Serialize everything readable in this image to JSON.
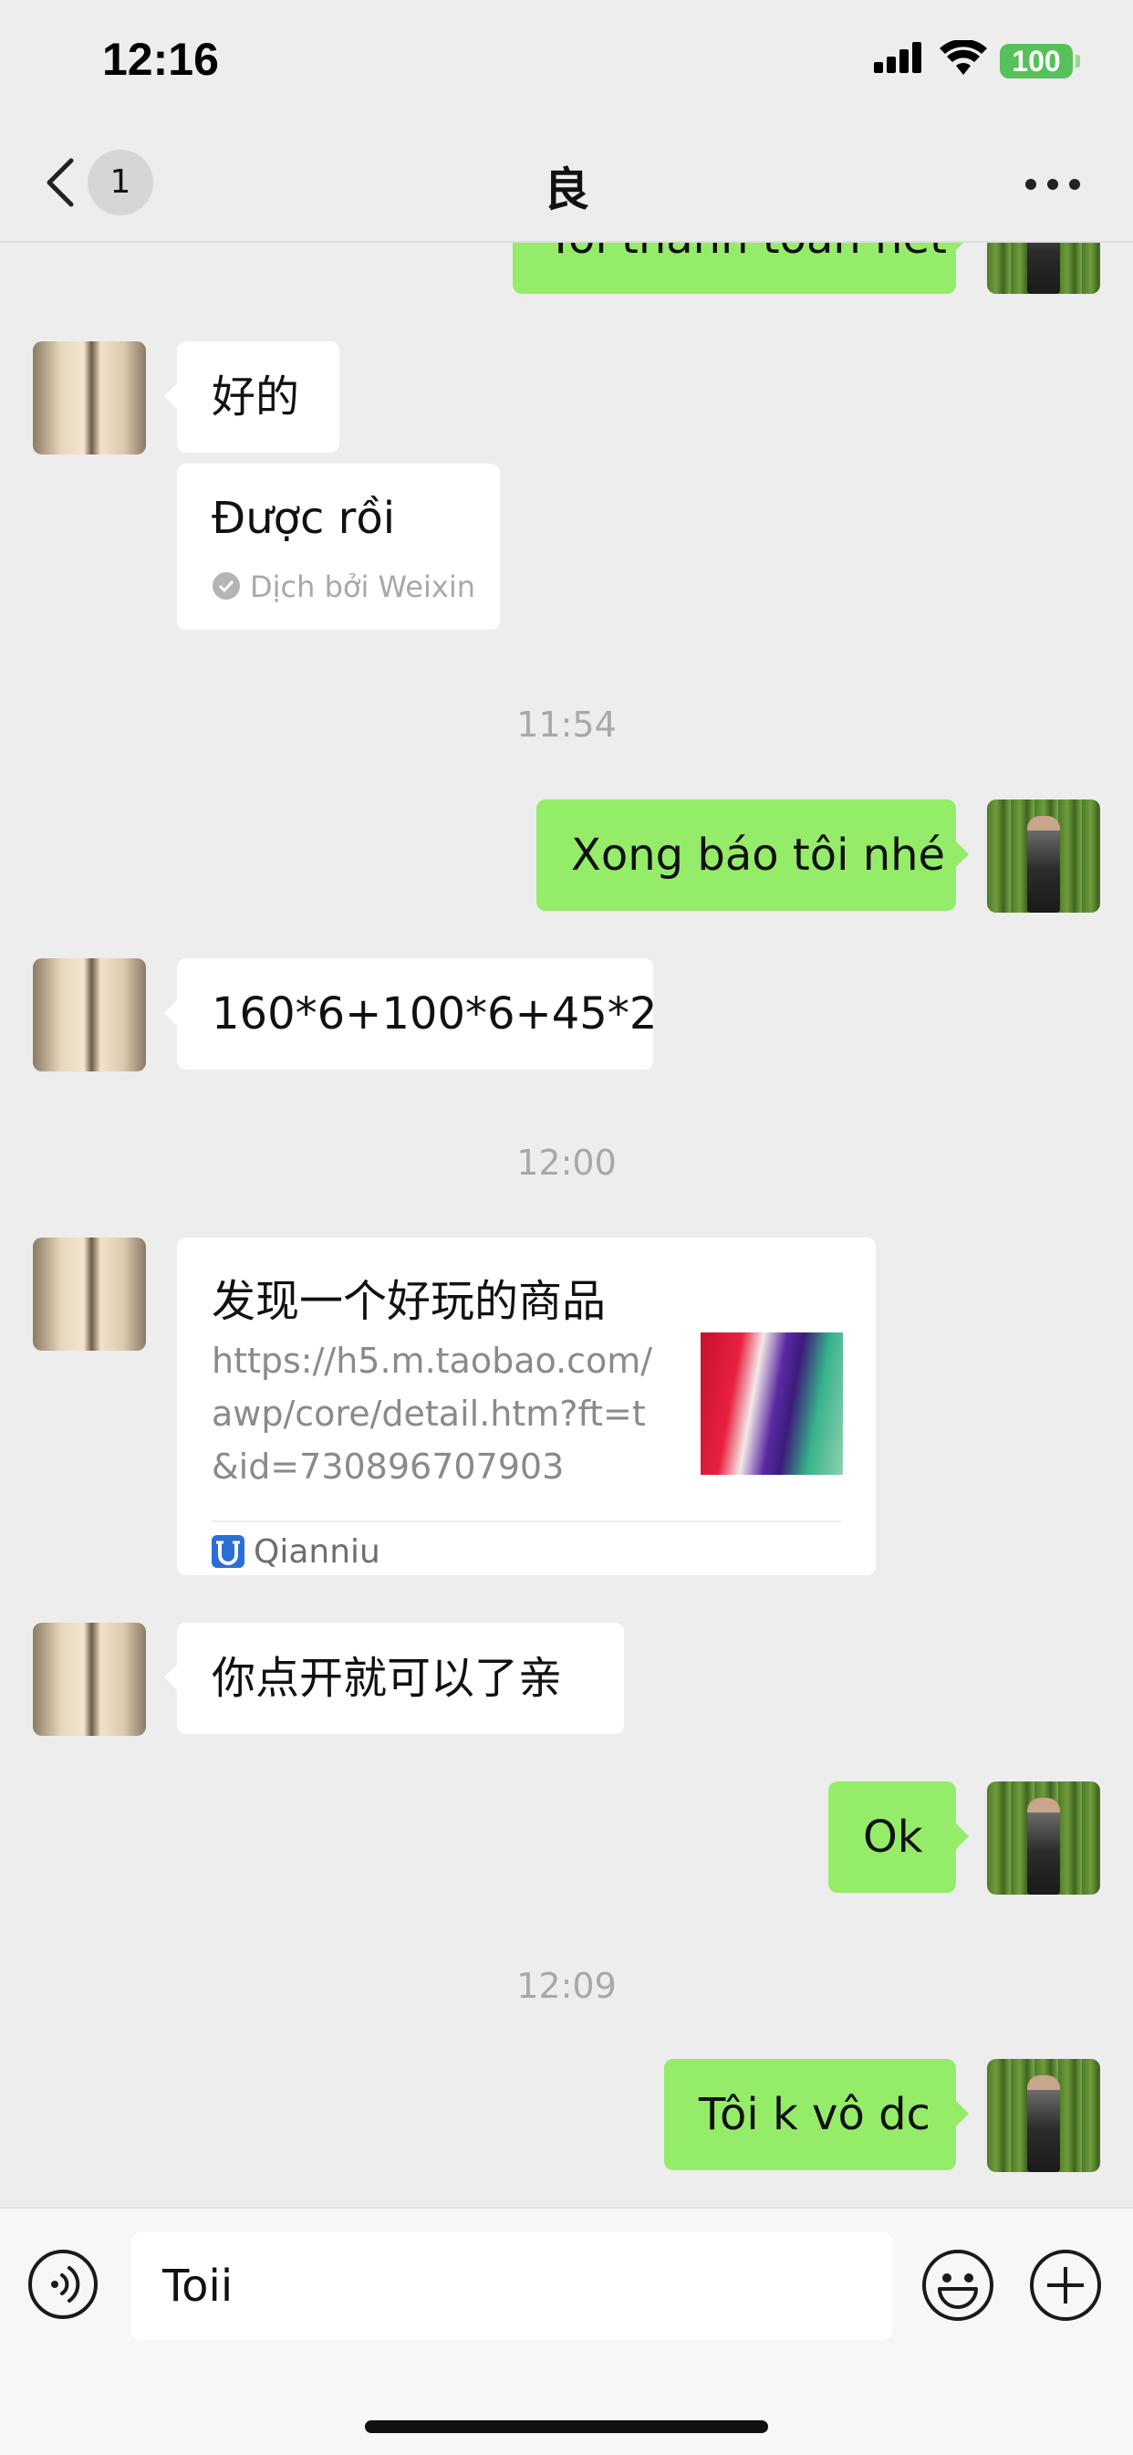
{
  "status": {
    "time": "12:16",
    "battery": "100"
  },
  "header": {
    "unread": "1",
    "title": "良"
  },
  "messages": {
    "m0": "Tôi thanh toán hết",
    "m1": "好的",
    "m2_translation": "Được rồi",
    "m2_source": "Dịch bởi Weixin",
    "ts1": "11:54",
    "m3": "Xong báo tôi nhé",
    "m4": "160*6+100*6+45*2",
    "ts2": "12:00",
    "card": {
      "title": "发现一个好玩的商品",
      "url_line1": "https://h5.m.taobao.com/",
      "url_line2": "awp/core/detail.htm?ft=t",
      "url_line3": "&id=730896707903",
      "source": "Qianniu"
    },
    "m5": "你点开就可以了亲",
    "m6": "Ok",
    "ts3": "12:09",
    "m7": "Tôi k vô dc"
  },
  "input": {
    "value": "Toii"
  },
  "colors": {
    "outgoing_bubble": "#95EC69",
    "incoming_bubble": "#FFFFFF",
    "background": "#EDEDED",
    "battery": "#56C15A"
  },
  "icons": [
    "signal-icon",
    "wifi-icon",
    "battery-icon",
    "back-chevron-icon",
    "more-icon",
    "check-circle-icon",
    "qianniu-icon",
    "voice-icon",
    "emoji-icon",
    "plus-icon"
  ]
}
